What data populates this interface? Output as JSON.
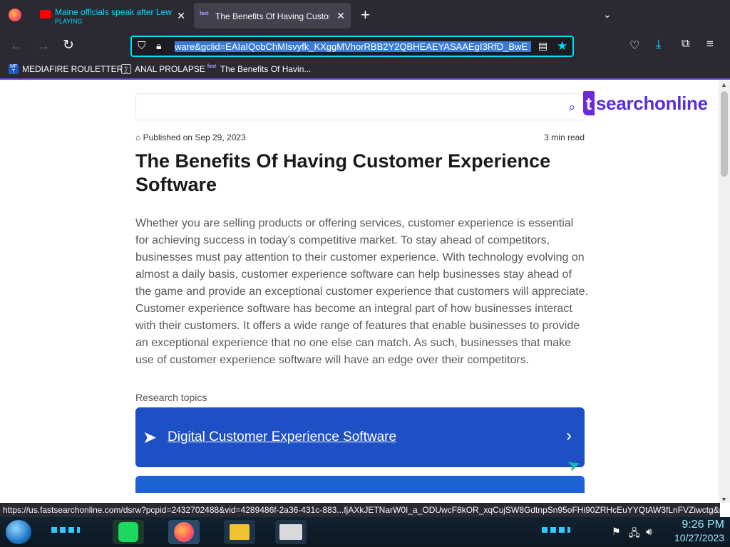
{
  "browser": {
    "tabs": [
      {
        "title": "Maine officials speak after Lew",
        "subtitle": "PLAYING",
        "icon": "youtube-icon"
      },
      {
        "title": "The Benefits Of Having Custom",
        "icon": "fast-icon"
      }
    ],
    "new_tab_label": "+",
    "url": "ware&gclid=EAIaIQobChMIsvyfk_KXggMVhorRBB2Y2QBHEAEYASAAEgI3RfD_BwE",
    "bookmarks": [
      {
        "label": "MEDIAFIRE ROULETTER",
        "icon": "mediafire-icon"
      },
      {
        "label": "ANAL PROLAPSE",
        "icon": "bookmark-icon"
      },
      {
        "label": "The Benefits Of Havin...",
        "icon": "fast-icon"
      }
    ],
    "status_url": "https://us.fastsearchonline.com/dsrw?pcpid=2432702488&vid=4289486f-2a36-431c-883...fjAXkJETNarW0I_a_ODUwcF8kOR_xqCujSW8GdtnpSn95oFHi90ZRHcEuYYQtAW3fLnFVZiwctg&nb=0"
  },
  "page": {
    "logo_letter": "t",
    "logo_word": "searchonline",
    "published": "Published on Sep 29, 2023",
    "read_time": "3 min read",
    "headline": "The Benefits Of Having Customer Experience Software",
    "paragraph": "Whether you are selling products or offering services, customer experience is essential for achieving success in today’s competitive market. To stay ahead of competitors, businesses must pay attention to their customer experience. With technology evolving on almost a daily basis, customer experience software can help businesses stay ahead of the game and provide an exceptional customer experience that customers will appreciate. Customer experience software has become an integral part of how businesses interact with their customers. It offers a wide range of features that enable businesses to provide an exceptional experience that no one else can match. As such, businesses that make use of customer experience software will have an edge over their competitors.",
    "research_label": "Research topics",
    "topics": [
      {
        "label": "Digital Customer Experience Software"
      }
    ]
  },
  "taskbar": {
    "time": "9:26 PM",
    "date": "10/27/2023"
  },
  "colors": {
    "accent": "#00ddff",
    "brand": "#5b2fd8",
    "topic_bg": "#1e4fc4"
  }
}
